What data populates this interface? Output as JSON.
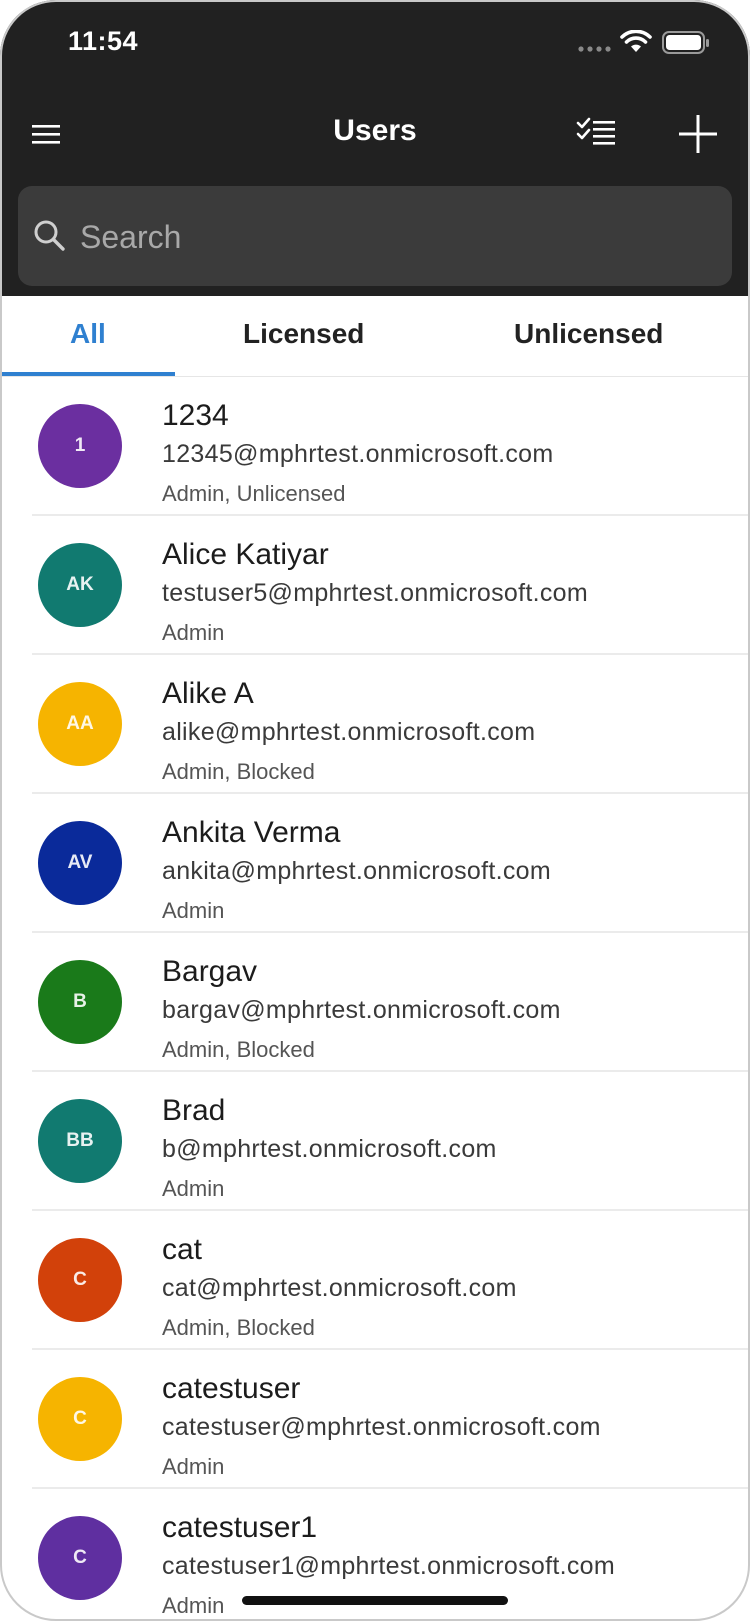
{
  "status": {
    "time": "11:54"
  },
  "header": {
    "title": "Users"
  },
  "search": {
    "placeholder": "Search"
  },
  "tabs": [
    {
      "label": "All",
      "active": true
    },
    {
      "label": "Licensed",
      "active": false
    },
    {
      "label": "Unlicensed",
      "active": false
    }
  ],
  "colors": {
    "header_bg": "#212121",
    "search_bg": "#3b3b3b",
    "accent": "#2f80d0"
  },
  "users": [
    {
      "initials": "1",
      "name": "1234",
      "email": "12345@mphrtest.onmicrosoft.com",
      "roles": "Admin, Unlicensed",
      "color": "#6b2fa0"
    },
    {
      "initials": "AK",
      "name": "Alice Katiyar",
      "email": "testuser5@mphrtest.onmicrosoft.com",
      "roles": "Admin",
      "color": "#117a70"
    },
    {
      "initials": "AA",
      "name": "Alike A",
      "email": "alike@mphrtest.onmicrosoft.com",
      "roles": "Admin, Blocked",
      "color": "#f6b400"
    },
    {
      "initials": "AV",
      "name": "Ankita Verma",
      "email": "ankita@mphrtest.onmicrosoft.com",
      "roles": "Admin",
      "color": "#0a2a9a"
    },
    {
      "initials": "B",
      "name": "Bargav",
      "email": "bargav@mphrtest.onmicrosoft.com",
      "roles": "Admin, Blocked",
      "color": "#1a7a1a"
    },
    {
      "initials": "BB",
      "name": "Brad",
      "email": "b@mphrtest.onmicrosoft.com",
      "roles": "Admin",
      "color": "#117a70"
    },
    {
      "initials": "C",
      "name": "cat",
      "email": "cat@mphrtest.onmicrosoft.com",
      "roles": "Admin, Blocked",
      "color": "#d2410a"
    },
    {
      "initials": "C",
      "name": "catestuser",
      "email": "catestuser@mphrtest.onmicrosoft.com",
      "roles": "Admin",
      "color": "#f6b400"
    },
    {
      "initials": "C",
      "name": "catestuser1",
      "email": "catestuser1@mphrtest.onmicrosoft.com",
      "roles": "Admin",
      "color": "#5f2fa0"
    }
  ]
}
